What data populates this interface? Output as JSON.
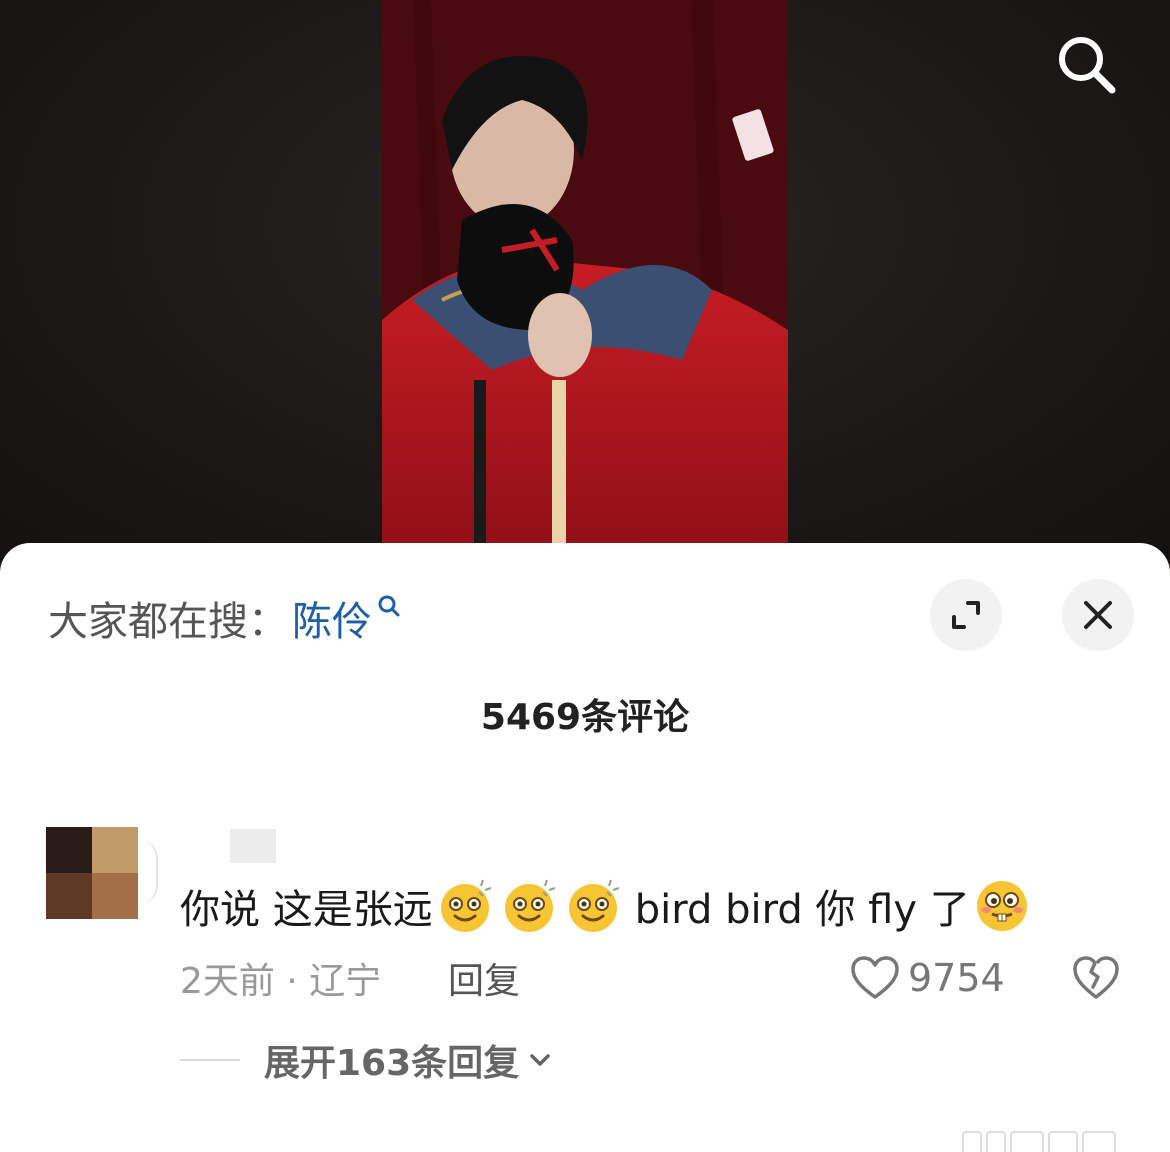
{
  "top": {
    "search_icon": "search-icon"
  },
  "sheet": {
    "hot_search_prefix": "大家都在搜：",
    "hot_search_term": "陈伶",
    "comment_count": "5469条评论",
    "expand_icon": "expand-icon",
    "close_icon": "close-icon"
  },
  "comment": {
    "text_part1": "你说 这是张远",
    "text_part2": "bird bird 你 fly 了",
    "time_location": "2天前 · 辽宁",
    "reply_label": "回复",
    "like_count": "9754",
    "expand_replies": "展开163条回复"
  },
  "colors": {
    "link_blue": "#1e5fa8",
    "sheet_bg": "#ffffff",
    "backdrop": "#1a1615"
  }
}
